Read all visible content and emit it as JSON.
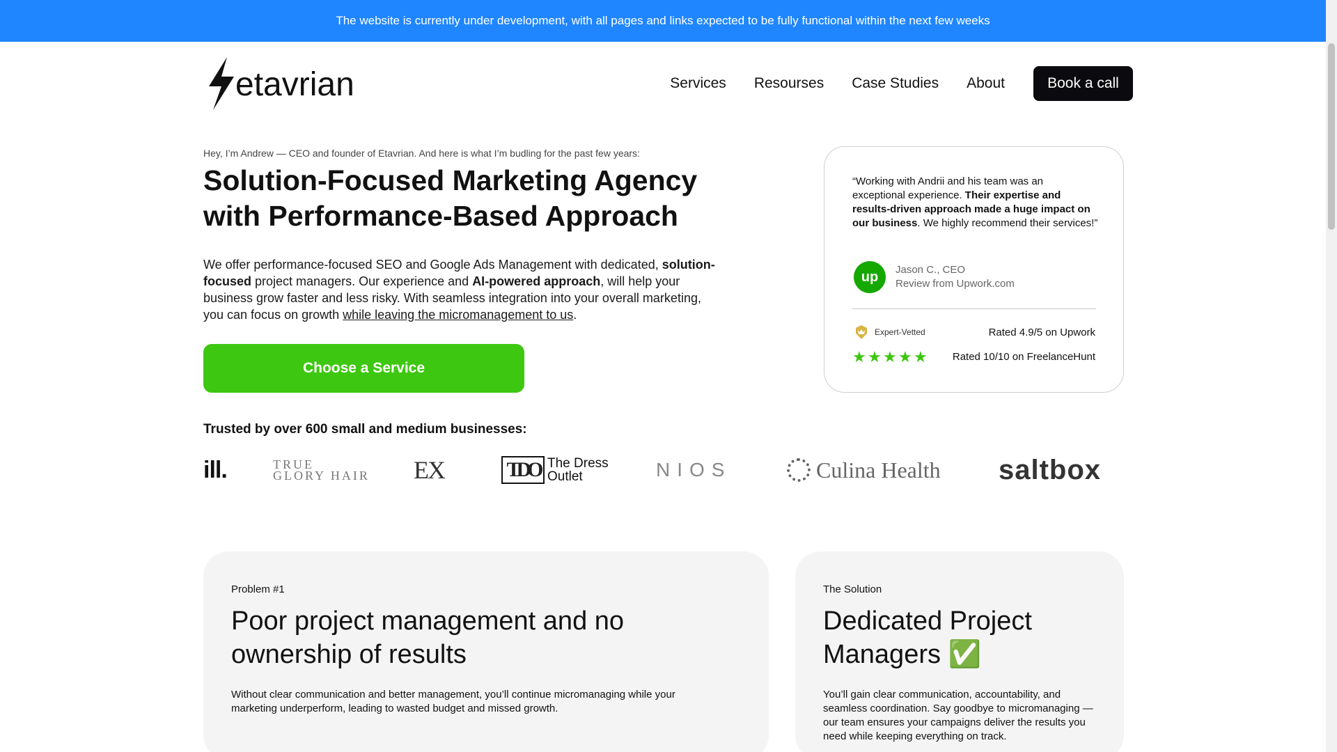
{
  "banner": {
    "text": "The website is currently under development, with all pages and links expected to be fully functional within the next few weeks"
  },
  "header": {
    "logo_text": "etavrian",
    "nav": [
      "Services",
      "Resourses",
      "Case Studies",
      "About"
    ],
    "cta": "Book a call"
  },
  "hero": {
    "intro": "Hey, I’m Andrew — CEO and founder of Etavrian. And here is what I’m budling for the past few years:",
    "title": "Solution-Focused Marketing Agency with Performance-Based Approach",
    "desc": {
      "p1": "We offer performance-focused SEO and Google Ads Management with dedicated, ",
      "b1": "solution-focused",
      "p2": " project managers. Our experience and ",
      "b2": "AI-powered approach",
      "p3": ", will help your business grow faster and less risky. With seamless integration into your overall marketing, you can focus on growth ",
      "link": "while leaving the micromanagement to us",
      "p4": "."
    },
    "cta": "Choose a Service"
  },
  "review": {
    "q1": "“Working with Andrii and his team was an exceptional experience. ",
    "qb": "Their expertise and results-driven approach made a huge impact on our business",
    "q2": ". We highly recommend their services!”",
    "logo": "up",
    "name": "Jason C., CEO",
    "source": "Review from Upwork.com",
    "vetted": "Expert-Vetted",
    "rating_upwork": "Rated 4.9/5 on Upwork",
    "stars": 5,
    "rating_fh": "Rated 10/10 on FreelanceHunt"
  },
  "trusted": {
    "heading": "Trusted by over 600 small and medium businesses:",
    "logos": {
      "ill": "ill.",
      "tg_1": "TRUE",
      "tg_2": "GLORY HAIR",
      "ex": "EX",
      "tdo_box": "TDO",
      "tdo_1": "The Dress",
      "tdo_2": "Outlet",
      "nios": "NIOS",
      "culina": "Culina Health",
      "salt": "saltbox"
    }
  },
  "problem": {
    "kicker": "Problem #1",
    "title": "Poor project management and no ownership of results",
    "desc": "Without clear communication and better management, you’ll continue micromanaging while your marketing underperform, leading to wasted budget and missed growth."
  },
  "solution": {
    "kicker": "The Solution",
    "title": "Dedicated Project Managers ✅",
    "desc": "You’ll gain clear communication, accountability, and seamless coordination. Say goodbye to micromanaging —our team ensures your campaigns deliver the results you need while keeping everything on track."
  },
  "colors": {
    "banner": "#1f86ff",
    "accent_green": "#3ec711",
    "dark": "#0b0b0f",
    "upwork": "#14a800"
  }
}
